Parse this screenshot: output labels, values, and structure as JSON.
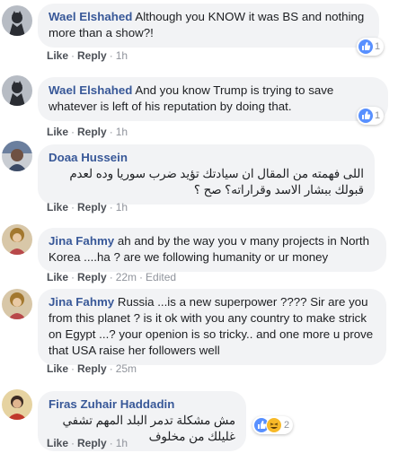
{
  "comments": [
    {
      "author": "Wael Elshahed",
      "text": "Although you KNOW it was BS and nothing more than a show?!",
      "like": "Like",
      "reply": "Reply",
      "time": "1h",
      "reaction_count": "1"
    },
    {
      "author": "Wael Elshahed",
      "text": "And you know Trump is trying to save whatever is left of his reputation by doing that.",
      "like": "Like",
      "reply": "Reply",
      "time": "1h",
      "reaction_count": "1"
    },
    {
      "author": "Doaa Hussein",
      "text": "اللى فهمته من المقال ان سيادتك تؤيد ضرب سوريا وده لعدم قبولك ببشار الاسد وقراراته؟ صح ؟",
      "like": "Like",
      "reply": "Reply",
      "time": "1h"
    },
    {
      "author": "Jina Fahmy",
      "text": "ah and by the way you v many projects in North Korea ....ha ? are we following humanity or ur money",
      "like": "Like",
      "reply": "Reply",
      "time": "22m",
      "edited": "Edited"
    },
    {
      "author": "Jina Fahmy",
      "text": "Russia ...is a new superpower ???? Sir are you from this planet ? is it ok with you any country to make strick on Egypt ...? your openion is so tricky.. and one more u prove that USA raise her followers well",
      "like": "Like",
      "reply": "Reply",
      "time": "25m"
    },
    {
      "author": "Firas Zuhair Haddadin",
      "text": "مش مشكلة تدمر البلد المهم تشفي غليلك من مخلوف",
      "like": "Like",
      "reply": "Reply",
      "time": "1h",
      "reaction_count": "2"
    }
  ],
  "colors": {
    "author": "#385898",
    "bubble": "#f2f3f5",
    "meta": "#90949c",
    "like_reaction": "#5890ff",
    "haha_reaction": "#f7b928"
  },
  "icons": {
    "like_reaction": "thumbs-up-icon",
    "haha_reaction": "laughing-face-icon"
  }
}
